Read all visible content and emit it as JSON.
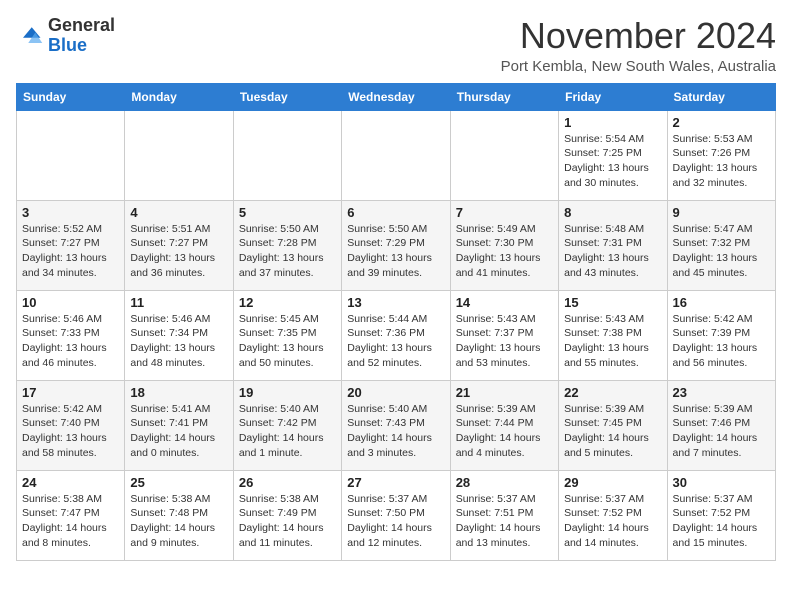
{
  "logo": {
    "general": "General",
    "blue": "Blue"
  },
  "header": {
    "month": "November 2024",
    "location": "Port Kembla, New South Wales, Australia"
  },
  "weekdays": [
    "Sunday",
    "Monday",
    "Tuesday",
    "Wednesday",
    "Thursday",
    "Friday",
    "Saturday"
  ],
  "weeks": [
    [
      {
        "day": "",
        "info": ""
      },
      {
        "day": "",
        "info": ""
      },
      {
        "day": "",
        "info": ""
      },
      {
        "day": "",
        "info": ""
      },
      {
        "day": "",
        "info": ""
      },
      {
        "day": "1",
        "info": "Sunrise: 5:54 AM\nSunset: 7:25 PM\nDaylight: 13 hours\nand 30 minutes."
      },
      {
        "day": "2",
        "info": "Sunrise: 5:53 AM\nSunset: 7:26 PM\nDaylight: 13 hours\nand 32 minutes."
      }
    ],
    [
      {
        "day": "3",
        "info": "Sunrise: 5:52 AM\nSunset: 7:27 PM\nDaylight: 13 hours\nand 34 minutes."
      },
      {
        "day": "4",
        "info": "Sunrise: 5:51 AM\nSunset: 7:27 PM\nDaylight: 13 hours\nand 36 minutes."
      },
      {
        "day": "5",
        "info": "Sunrise: 5:50 AM\nSunset: 7:28 PM\nDaylight: 13 hours\nand 37 minutes."
      },
      {
        "day": "6",
        "info": "Sunrise: 5:50 AM\nSunset: 7:29 PM\nDaylight: 13 hours\nand 39 minutes."
      },
      {
        "day": "7",
        "info": "Sunrise: 5:49 AM\nSunset: 7:30 PM\nDaylight: 13 hours\nand 41 minutes."
      },
      {
        "day": "8",
        "info": "Sunrise: 5:48 AM\nSunset: 7:31 PM\nDaylight: 13 hours\nand 43 minutes."
      },
      {
        "day": "9",
        "info": "Sunrise: 5:47 AM\nSunset: 7:32 PM\nDaylight: 13 hours\nand 45 minutes."
      }
    ],
    [
      {
        "day": "10",
        "info": "Sunrise: 5:46 AM\nSunset: 7:33 PM\nDaylight: 13 hours\nand 46 minutes."
      },
      {
        "day": "11",
        "info": "Sunrise: 5:46 AM\nSunset: 7:34 PM\nDaylight: 13 hours\nand 48 minutes."
      },
      {
        "day": "12",
        "info": "Sunrise: 5:45 AM\nSunset: 7:35 PM\nDaylight: 13 hours\nand 50 minutes."
      },
      {
        "day": "13",
        "info": "Sunrise: 5:44 AM\nSunset: 7:36 PM\nDaylight: 13 hours\nand 52 minutes."
      },
      {
        "day": "14",
        "info": "Sunrise: 5:43 AM\nSunset: 7:37 PM\nDaylight: 13 hours\nand 53 minutes."
      },
      {
        "day": "15",
        "info": "Sunrise: 5:43 AM\nSunset: 7:38 PM\nDaylight: 13 hours\nand 55 minutes."
      },
      {
        "day": "16",
        "info": "Sunrise: 5:42 AM\nSunset: 7:39 PM\nDaylight: 13 hours\nand 56 minutes."
      }
    ],
    [
      {
        "day": "17",
        "info": "Sunrise: 5:42 AM\nSunset: 7:40 PM\nDaylight: 13 hours\nand 58 minutes."
      },
      {
        "day": "18",
        "info": "Sunrise: 5:41 AM\nSunset: 7:41 PM\nDaylight: 14 hours\nand 0 minutes."
      },
      {
        "day": "19",
        "info": "Sunrise: 5:40 AM\nSunset: 7:42 PM\nDaylight: 14 hours\nand 1 minute."
      },
      {
        "day": "20",
        "info": "Sunrise: 5:40 AM\nSunset: 7:43 PM\nDaylight: 14 hours\nand 3 minutes."
      },
      {
        "day": "21",
        "info": "Sunrise: 5:39 AM\nSunset: 7:44 PM\nDaylight: 14 hours\nand 4 minutes."
      },
      {
        "day": "22",
        "info": "Sunrise: 5:39 AM\nSunset: 7:45 PM\nDaylight: 14 hours\nand 5 minutes."
      },
      {
        "day": "23",
        "info": "Sunrise: 5:39 AM\nSunset: 7:46 PM\nDaylight: 14 hours\nand 7 minutes."
      }
    ],
    [
      {
        "day": "24",
        "info": "Sunrise: 5:38 AM\nSunset: 7:47 PM\nDaylight: 14 hours\nand 8 minutes."
      },
      {
        "day": "25",
        "info": "Sunrise: 5:38 AM\nSunset: 7:48 PM\nDaylight: 14 hours\nand 9 minutes."
      },
      {
        "day": "26",
        "info": "Sunrise: 5:38 AM\nSunset: 7:49 PM\nDaylight: 14 hours\nand 11 minutes."
      },
      {
        "day": "27",
        "info": "Sunrise: 5:37 AM\nSunset: 7:50 PM\nDaylight: 14 hours\nand 12 minutes."
      },
      {
        "day": "28",
        "info": "Sunrise: 5:37 AM\nSunset: 7:51 PM\nDaylight: 14 hours\nand 13 minutes."
      },
      {
        "day": "29",
        "info": "Sunrise: 5:37 AM\nSunset: 7:52 PM\nDaylight: 14 hours\nand 14 minutes."
      },
      {
        "day": "30",
        "info": "Sunrise: 5:37 AM\nSunset: 7:52 PM\nDaylight: 14 hours\nand 15 minutes."
      }
    ]
  ]
}
